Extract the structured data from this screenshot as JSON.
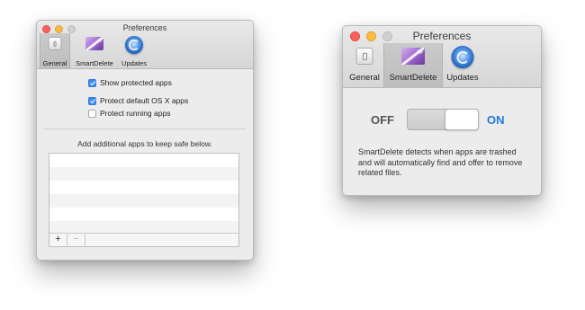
{
  "windows": [
    {
      "title": "Preferences",
      "tabs": [
        {
          "label": "General",
          "icon": "general-icon",
          "selected": true
        },
        {
          "label": "SmartDelete",
          "icon": "smartdelete-icon",
          "selected": false
        },
        {
          "label": "Updates",
          "icon": "updates-icon",
          "selected": false
        }
      ],
      "options": [
        {
          "label": "Show protected apps",
          "checked": true
        },
        {
          "label": "Protect default OS X apps",
          "checked": true
        },
        {
          "label": "Protect running apps",
          "checked": false
        }
      ],
      "hint": "Add additional apps to keep safe below.",
      "list_buttons": {
        "add": "+",
        "remove": "−"
      }
    },
    {
      "title": "Preferences",
      "tabs": [
        {
          "label": "General",
          "icon": "general-icon",
          "selected": false
        },
        {
          "label": "SmartDelete",
          "icon": "smartdelete-icon",
          "selected": true
        },
        {
          "label": "Updates",
          "icon": "updates-icon",
          "selected": false
        }
      ],
      "toggle": {
        "off_label": "OFF",
        "on_label": "ON",
        "state": "on"
      },
      "description": "SmartDelete detects when apps are trashed and will automatically find and offer to remove related files."
    }
  ],
  "colors": {
    "accent": "#1f7ae0",
    "checkbox_on": "#3b8ef0",
    "close": "#fc605c",
    "minimize": "#fdbc40",
    "zoom_inactive": "#cfcfcf"
  }
}
